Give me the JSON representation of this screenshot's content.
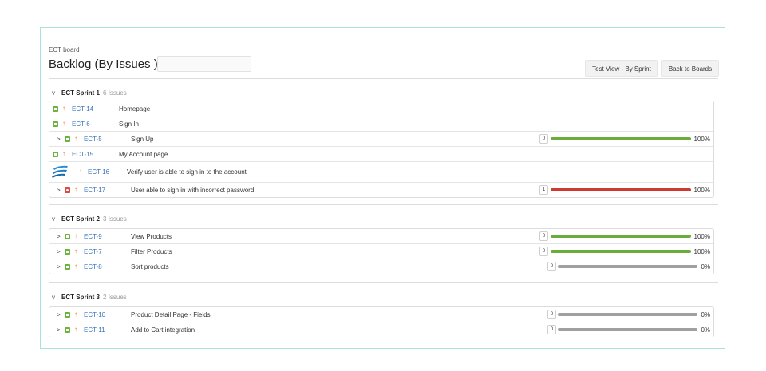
{
  "board": {
    "name": "ECT board",
    "title": "Backlog (By Issues )",
    "title_input": "",
    "buttons": {
      "test_view": "Test View - By Sprint",
      "back": "Back to Boards"
    }
  },
  "colors": {
    "story": "#6db33f",
    "bug": "#e0483e",
    "green_bar": "#6aad3a",
    "red_bar": "#cc3a30",
    "grey_bar": "#a0a0a0",
    "link": "#3b73b9",
    "priority": "#e8732c"
  },
  "sprints": [
    {
      "name": "ECT Sprint 1",
      "count": "6 Issues",
      "chevron": "v",
      "rows": [
        {
          "expand": "",
          "icon": "story-icon",
          "key": "ECT-14",
          "summary": "Homepage",
          "done": true
        },
        {
          "expand": "",
          "icon": "story-icon",
          "key": "ECT-6",
          "summary": "Sign In"
        },
        {
          "expand": ">",
          "icon": "story-icon",
          "key": "ECT-5",
          "summary": "Sign Up",
          "badge": "0",
          "progress": 1.0,
          "pct": "100%",
          "bar": "green"
        },
        {
          "expand": "",
          "icon": "story-icon",
          "key": "ECT-15",
          "summary": "My Account page"
        },
        {
          "expand": "",
          "icon": "app-logo-icon",
          "key": "ECT-16",
          "summary": "Verify user is able to sign in to the account",
          "tall": true
        },
        {
          "expand": ">",
          "icon": "bug-icon",
          "key": "ECT-17",
          "summary": "User able to sign in with incorrect password",
          "badge": "1",
          "progress": 1.0,
          "pct": "100%",
          "bar": "red"
        }
      ]
    },
    {
      "name": "ECT Sprint 2",
      "count": "3 Issues",
      "chevron": "v",
      "rows": [
        {
          "expand": ">",
          "icon": "story-icon",
          "key": "ECT-9",
          "summary": "View Products",
          "badge": "0",
          "progress": 1.0,
          "pct": "100%",
          "bar": "green"
        },
        {
          "expand": ">",
          "icon": "story-icon",
          "key": "ECT-7",
          "summary": "Filter Products",
          "badge": "0",
          "progress": 1.0,
          "pct": "100%",
          "bar": "green"
        },
        {
          "expand": ">",
          "icon": "story-icon",
          "key": "ECT-8",
          "summary": "Sort products",
          "badge": "0",
          "progress": 0,
          "pct": "0%",
          "bar": "grey"
        }
      ]
    },
    {
      "name": "ECT Sprint 3",
      "count": "2 Issues",
      "chevron": "v",
      "rows": [
        {
          "expand": ">",
          "icon": "story-icon",
          "key": "ECT-10",
          "summary": "Product Detail Page - Fields",
          "badge": "0",
          "progress": 0,
          "pct": "0%",
          "bar": "grey"
        },
        {
          "expand": ">",
          "icon": "story-icon",
          "key": "ECT-11",
          "summary": "Add to Cart integration",
          "badge": "0",
          "progress": 0,
          "pct": "0%",
          "bar": "grey"
        }
      ]
    }
  ]
}
